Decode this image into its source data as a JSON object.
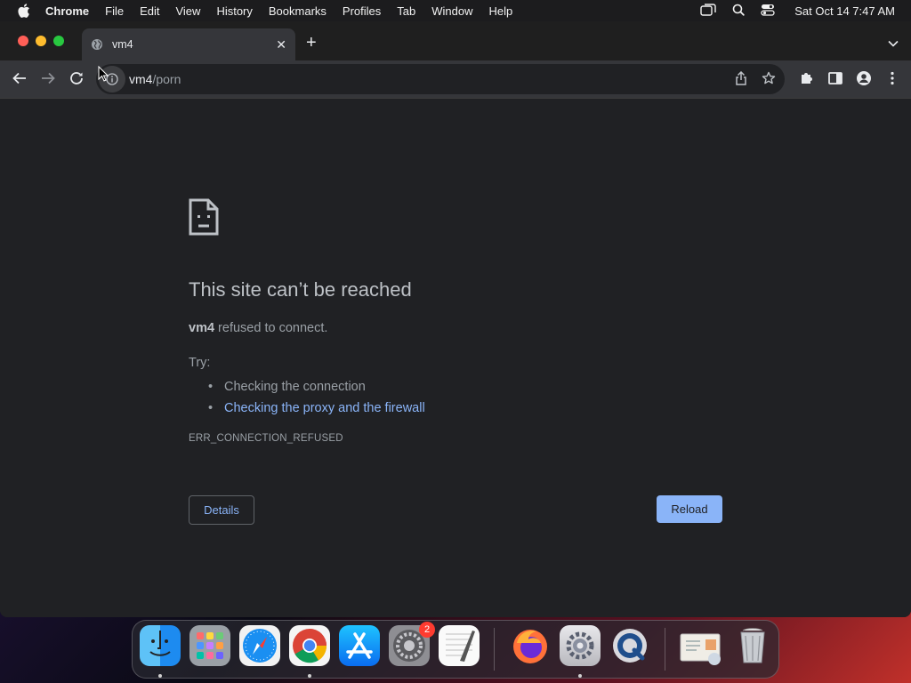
{
  "menubar": {
    "app_name": "Chrome",
    "items": [
      "File",
      "Edit",
      "View",
      "History",
      "Bookmarks",
      "Profiles",
      "Tab",
      "Window",
      "Help"
    ],
    "clock": "Sat Oct 14  7:47 AM"
  },
  "tab": {
    "title": "vm4",
    "close": "✕",
    "new_tab": "+"
  },
  "omnibox": {
    "host": "vm4",
    "path": "/porn"
  },
  "error_page": {
    "title": "This site can’t be reached",
    "host": "vm4",
    "description": " refused to connect.",
    "try_label": "Try:",
    "suggestions": [
      "Checking the connection",
      "Checking the proxy and the firewall"
    ],
    "error_code": "ERR_CONNECTION_REFUSED",
    "details_button": "Details",
    "reload_button": "Reload"
  },
  "dock": {
    "apps": [
      "finder",
      "launchpad",
      "safari",
      "chrome",
      "app-store",
      "system-preferences",
      "textedit",
      "firefox",
      "system-settings",
      "quicktime",
      "preview-documents",
      "trash"
    ],
    "system_preferences_badge": "2"
  },
  "colors": {
    "accent_blue": "#8ab4f8",
    "page_bg": "#202124",
    "toolbar_bg": "#35363a"
  }
}
